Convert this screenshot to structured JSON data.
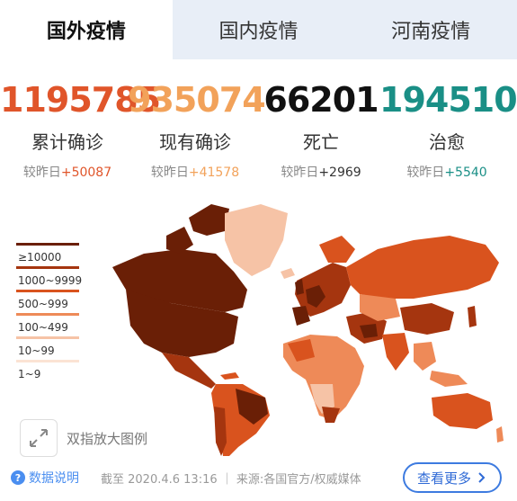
{
  "tabs": [
    "国外疫情",
    "国内疫情",
    "河南疫情"
  ],
  "stats": [
    {
      "value": "1195785",
      "label": "累计确诊",
      "delta_prefix": "较昨日",
      "delta": "+50087",
      "color": "#e0552a",
      "delta_color": "#e0552a"
    },
    {
      "value": "935074",
      "label": "现有确诊",
      "delta_prefix": "较昨日",
      "delta": "+41578",
      "color": "#f2a25a",
      "delta_color": "#f2a25a"
    },
    {
      "value": "66201",
      "label": "死亡",
      "delta_prefix": "较昨日",
      "delta": "+2969",
      "color": "#111111",
      "delta_color": "#333333"
    },
    {
      "value": "194510",
      "label": "治愈",
      "delta_prefix": "较昨日",
      "delta": "+5540",
      "color": "#1a8f86",
      "delta_color": "#1a8f86"
    }
  ],
  "legend": [
    {
      "label": "≥10000",
      "color": "#6a1f06"
    },
    {
      "label": "1000~9999",
      "color": "#a5350f"
    },
    {
      "label": "500~999",
      "color": "#d9531e"
    },
    {
      "label": "100~499",
      "color": "#ee8a58"
    },
    {
      "label": "10~99",
      "color": "#f6c3a6"
    },
    {
      "label": "1~9",
      "color": "#fbe3d4"
    }
  ],
  "pinch_hint": "双指放大图例",
  "footer": {
    "data_note": "数据说明",
    "source": "截至 2020.4.6 13:16 ｜ 来源:各国官方/权威媒体",
    "more_button": "查看更多"
  },
  "icons": {
    "pinch": "expand-arrows-icon",
    "help": "question-icon",
    "more": "chevron-right-icon"
  }
}
